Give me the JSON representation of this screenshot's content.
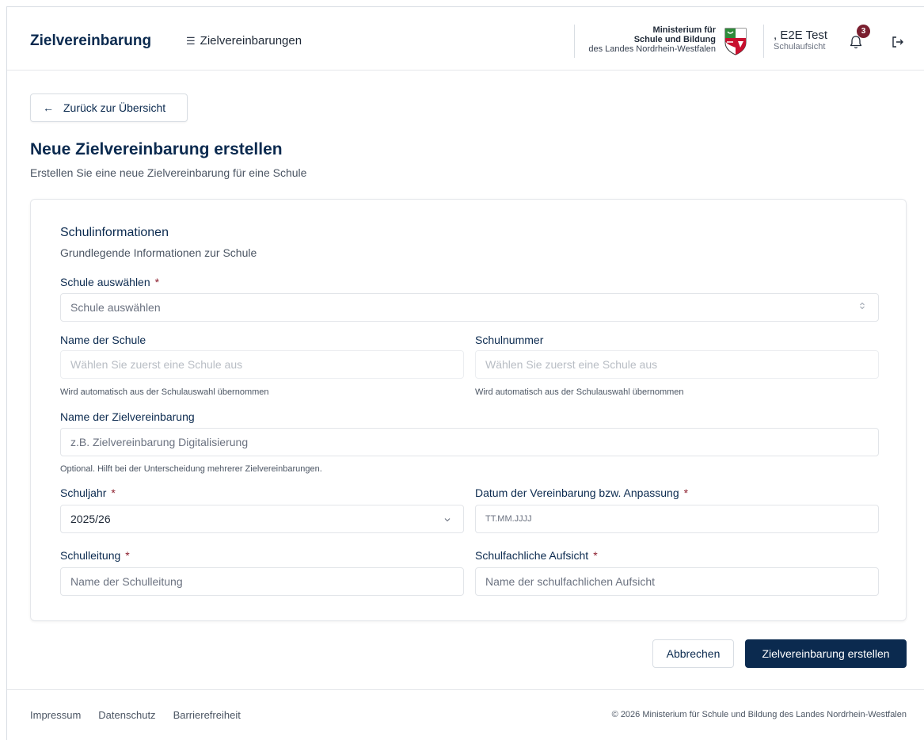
{
  "header": {
    "brand": "Zielvereinbarung",
    "nav_label": "Zielvereinbarungen",
    "ministry_line1": "Ministerium für",
    "ministry_line2": "Schule und Bildung",
    "ministry_line3": "des Landes Nordrhein-Westfalen",
    "user_name": ", E2E Test",
    "user_role": "Schulaufsicht",
    "notification_count": "3"
  },
  "back_button": "Zurück zur Übersicht",
  "page": {
    "title": "Neue Zielvereinbarung erstellen",
    "subtitle": "Erstellen Sie eine neue Zielvereinbarung für eine Schule"
  },
  "section": {
    "title": "Schulinformationen",
    "subtitle": "Grundlegende Informationen zur Schule"
  },
  "form": {
    "school_select": {
      "label": "Schule auswählen",
      "placeholder": "Schule auswählen"
    },
    "school_name": {
      "label": "Name der Schule",
      "placeholder": "Wählen Sie zuerst eine Schule aus",
      "hint": "Wird automatisch aus der Schulauswahl übernommen"
    },
    "school_number": {
      "label": "Schulnummer",
      "placeholder": "Wählen Sie zuerst eine Schule aus",
      "hint": "Wird automatisch aus der Schulauswahl übernommen"
    },
    "agreement_name": {
      "label": "Name der Zielvereinbarung",
      "placeholder": "z.B. Zielvereinbarung Digitalisierung",
      "hint": "Optional. Hilft bei der Unterscheidung mehrerer Zielvereinbarungen."
    },
    "school_year": {
      "label": "Schuljahr",
      "value": "2025/26"
    },
    "agreement_date": {
      "label": "Datum der Vereinbarung bzw. Anpassung",
      "placeholder": "TT.MM.JJJJ"
    },
    "school_head": {
      "label": "Schulleitung",
      "placeholder": "Name der Schulleitung"
    },
    "supervision": {
      "label": "Schulfachliche Aufsicht",
      "placeholder": "Name der schulfachlichen Aufsicht"
    },
    "required_mark": "*"
  },
  "actions": {
    "cancel": "Abbrechen",
    "submit": "Zielvereinbarung erstellen"
  },
  "footer": {
    "links": [
      "Impressum",
      "Datenschutz",
      "Barrierefreiheit"
    ],
    "copyright": "© 2026 Ministerium für Schule und Bildung des Landes Nordrhein-Westfalen"
  },
  "colors": {
    "primary": "#0b2a4f",
    "required": "#8b1d2c",
    "badge": "#7a1f2f"
  },
  "icons": [
    "list-icon",
    "arrow-left-icon",
    "crest-icon",
    "bell-icon",
    "logout-icon",
    "select-updown-icon",
    "chevron-down-icon"
  ]
}
